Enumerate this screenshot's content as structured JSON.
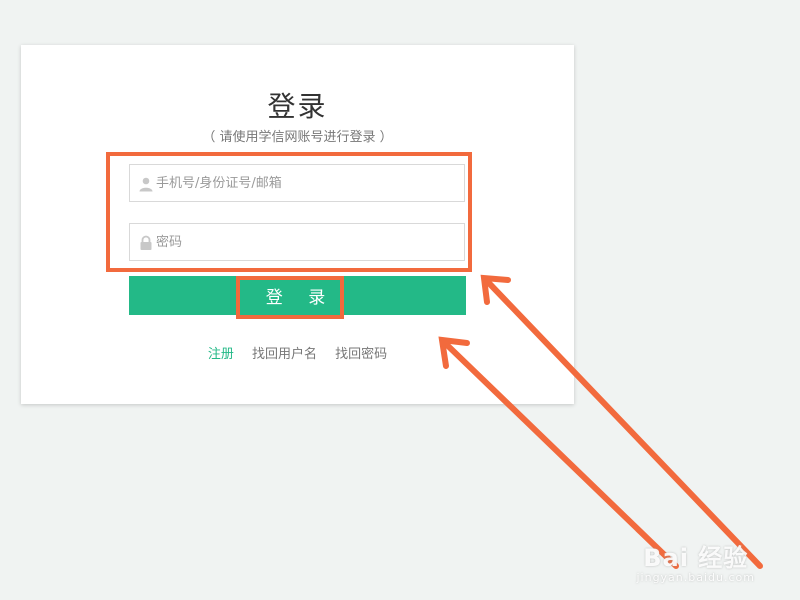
{
  "login": {
    "title": "登录",
    "subtitle": "（ 请使用学信网账号进行登录 ）",
    "username_placeholder": "手机号/身份证号/邮箱",
    "password_placeholder": "密码",
    "submit_label": "登 录",
    "links": {
      "register": "注册",
      "find_username": "找回用户名",
      "find_password": "找回密码"
    }
  },
  "watermark": {
    "brand": "Bai 经验",
    "url": "jingyan.baidu.com"
  },
  "colors": {
    "accent": "#23b987",
    "annotation": "#f26a3d"
  },
  "icons": {
    "username": "user-icon",
    "password": "lock-icon"
  }
}
